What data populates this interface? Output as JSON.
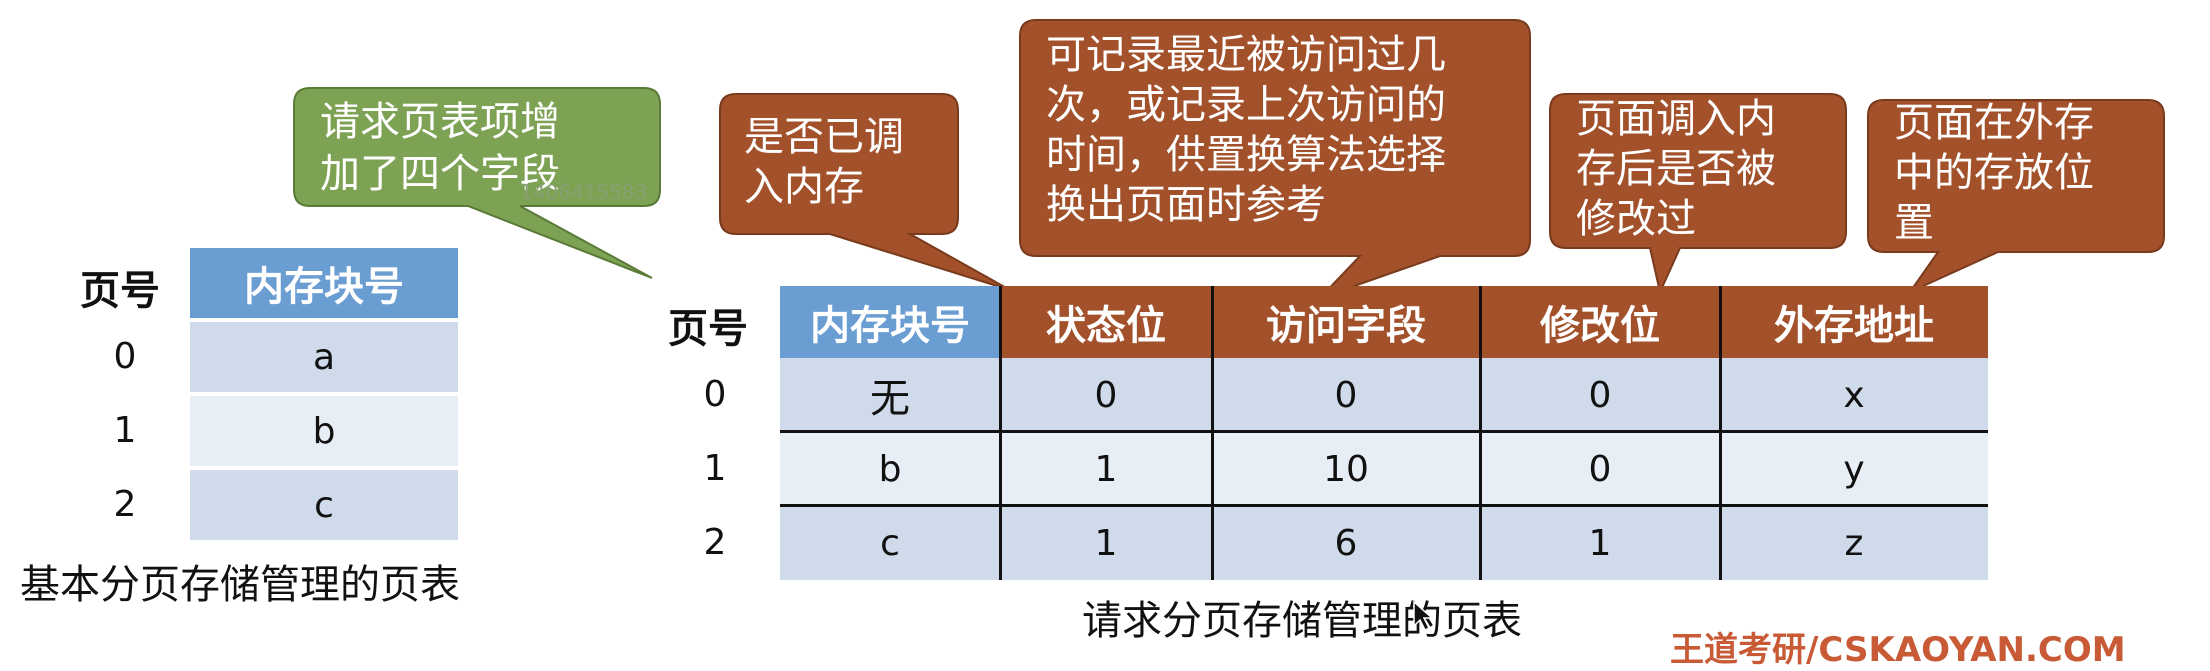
{
  "basic_table": {
    "pageno_header": "页号",
    "block_header": "内存块号",
    "rows": [
      {
        "page": "0",
        "block": "a"
      },
      {
        "page": "1",
        "block": "b"
      },
      {
        "page": "2",
        "block": "c"
      }
    ],
    "caption": "基本分页存储管理的页表"
  },
  "demand_table": {
    "pageno_header": "页号",
    "headers": [
      "内存块号",
      "状态位",
      "访问字段",
      "修改位",
      "外存地址"
    ],
    "rows": [
      {
        "page": "0",
        "cells": [
          "无",
          "0",
          "0",
          "0",
          "x"
        ]
      },
      {
        "page": "1",
        "cells": [
          "b",
          "1",
          "10",
          "0",
          "y"
        ]
      },
      {
        "page": "2",
        "cells": [
          "c",
          "1",
          "6",
          "1",
          "z"
        ]
      }
    ],
    "caption": "请求分页存储管理的页表"
  },
  "callouts": {
    "green": "请求页表项增\n加了四个字段",
    "status": "是否已调\n入内存",
    "access": "可记录最近被访问过几\n次，或记录上次访问的\n时间，供置换算法选择\n换出页面时参考",
    "modify": "页面调入内\n存后是否被\n修改过",
    "address": "页面在外存\n中的存放位\n置"
  },
  "watermark": "1406415583",
  "footer_brand": "王道考研/CSKAOYAN.COM",
  "colors": {
    "blue_header": "#6a9dd2",
    "orange_header": "#a3512b",
    "green_callout": "#7ea254",
    "row_a": "#cfdbea",
    "row_b": "#e8eef6"
  }
}
